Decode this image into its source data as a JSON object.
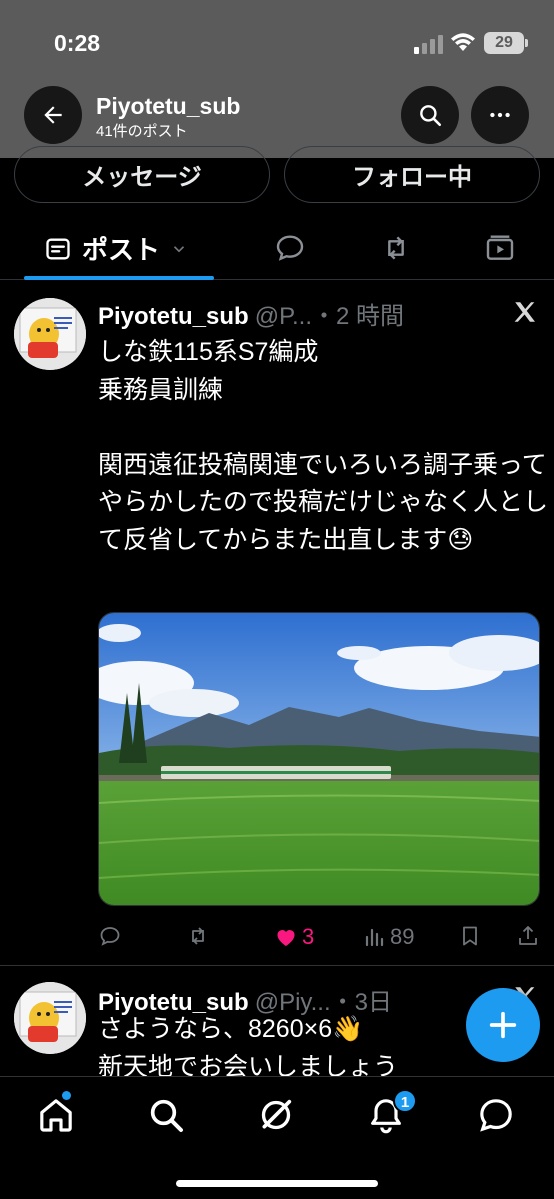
{
  "status_bar": {
    "time": "0:28",
    "battery": "29"
  },
  "header": {
    "name": "Piyotetu_sub",
    "post_count": "41件のポスト"
  },
  "profile_actions": {
    "message_label": "メッセージ",
    "following_label": "フォロー中"
  },
  "tabs": {
    "posts_label": "ポスト"
  },
  "posts": [
    {
      "name": "Piyotetu_sub",
      "handle": "@P...",
      "time": "・2 時間",
      "text": "しな鉄115系S7編成\n乗務員訓練\n\n関西遠征投稿関連でいろいろ調子乗ってやらかしたので投稿だけじゃなく人として反省してからまた出直します😓",
      "stats": {
        "replies": "",
        "reposts": "",
        "likes": "3",
        "views": "89"
      }
    },
    {
      "name": "Piyotetu_sub",
      "handle": "@Piy...",
      "time": "・3日",
      "text": "さようなら、8260×6👋\n新天地でお会いしましょう"
    }
  ],
  "tabbar": {
    "notifications_badge": "1"
  },
  "icons": {
    "back": "arrow-left-icon",
    "search": "search-icon",
    "more": "more-icon",
    "posts_tab": "posts-icon",
    "replies_tab": "reply-icon",
    "reposts_tab": "repost-icon",
    "media_tab": "video-icon",
    "x_logo": "x-logo",
    "compose": "plus-icon",
    "home": "home-icon",
    "explore": "search-icon",
    "grok": "grok-icon",
    "notifications": "bell-icon",
    "messages": "message-icon"
  },
  "colors": {
    "accent": "#1d9bf0",
    "like": "#f91880",
    "header_bg": "#5b5b5b",
    "muted": "#71767b"
  }
}
